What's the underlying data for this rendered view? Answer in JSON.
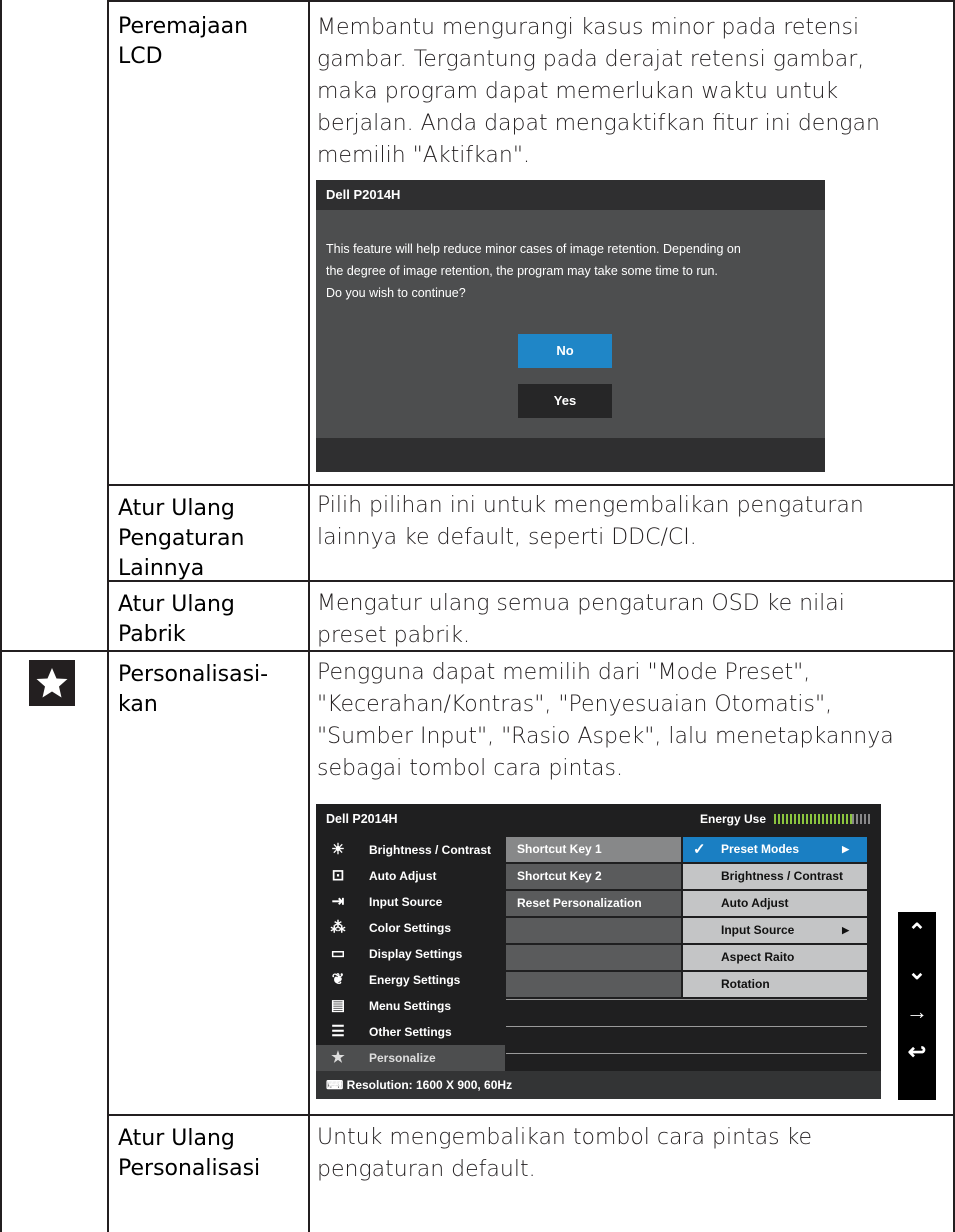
{
  "rows": [
    {
      "name": [
        "Peremajaan",
        "LCD"
      ],
      "desc": [
        "Membantu mengurangi kasus minor pada retensi",
        "gambar. Tergantung pada derajat retensi gambar,",
        "maka program dapat memerlukan waktu untuk",
        "berjalan. Anda dapat mengaktifkan fitur ini dengan",
        "memilih \"Aktifkan\"."
      ]
    },
    {
      "name": [
        "Atur Ulang",
        "Pengaturan",
        "Lainnya"
      ],
      "desc": [
        "Pilih pilihan ini untuk mengembalikan pengaturan",
        "lainnya ke default, seperti DDC/CI."
      ]
    },
    {
      "name": [
        "Atur Ulang",
        "Pabrik"
      ],
      "desc": [
        "Mengatur ulang semua pengaturan OSD ke nilai",
        "preset pabrik."
      ]
    },
    {
      "name": [
        "Personalisasi-",
        "kan"
      ],
      "desc": [
        "Pengguna dapat memilih dari \"Mode Preset\",",
        "\"Kecerahan/Kontras\", \"Penyesuaian Otomatis\",",
        "\"Sumber Input\", \"Rasio Aspek\", lalu menetapkannya",
        "sebagai tombol cara pintas."
      ]
    },
    {
      "name": [
        "Atur Ulang",
        "Personalisasi"
      ],
      "desc": [
        "Untuk mengembalikan tombol cara pintas ke",
        "pengaturan default."
      ]
    }
  ],
  "dialog": {
    "title": "Dell P2014H",
    "message": [
      "This feature will help reduce minor cases of image retention. Depending on",
      "the degree of image retention, the program may take some time to run.",
      "Do you wish to continue?"
    ],
    "no": "No",
    "yes": "Yes"
  },
  "osd": {
    "title": "Dell P2014H",
    "energy_label": "Energy Use",
    "menu": [
      {
        "label": "Brightness / Contrast",
        "icon": "brightness-icon"
      },
      {
        "label": "Auto Adjust",
        "icon": "auto-adjust-icon"
      },
      {
        "label": "Input Source",
        "icon": "input-source-icon"
      },
      {
        "label": "Color Settings",
        "icon": "color-settings-icon"
      },
      {
        "label": "Display Settings",
        "icon": "display-settings-icon"
      },
      {
        "label": "Energy Settings",
        "icon": "energy-settings-icon"
      },
      {
        "label": "Menu Settings",
        "icon": "menu-settings-icon"
      },
      {
        "label": "Other Settings",
        "icon": "other-settings-icon"
      },
      {
        "label": "Personalize",
        "icon": "star-icon"
      }
    ],
    "shortcut": [
      "Shortcut Key 1",
      "Shortcut Key 2",
      "Reset Personalization"
    ],
    "options": [
      "Preset Modes",
      "Brightness / Contrast",
      "Auto Adjust",
      "Input Source",
      "Aspect Raito",
      "Rotation"
    ],
    "resolution_label": "Resolution: 1600 X 900, 60Hz"
  },
  "nav_icons": [
    "up-icon",
    "down-icon",
    "enter-icon",
    "back-icon"
  ]
}
